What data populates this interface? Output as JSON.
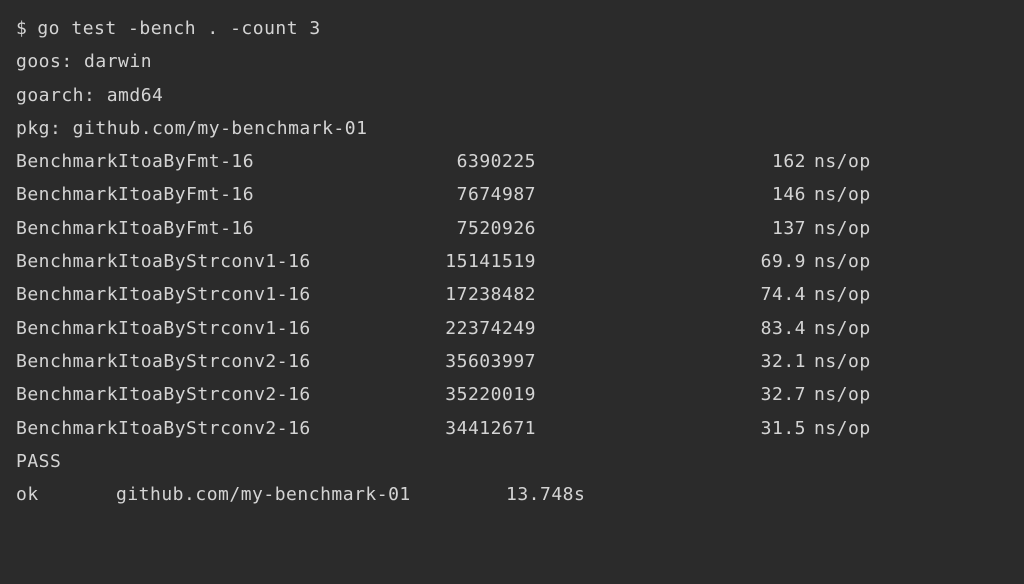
{
  "prompt_symbol": "$",
  "command": "go test -bench . -count 3",
  "header": {
    "goos_line": "goos: darwin",
    "goarch_line": "goarch: amd64",
    "pkg_line": "pkg: github.com/my-benchmark-01"
  },
  "rows": [
    {
      "name": "BenchmarkItoaByFmt-16",
      "iters": "6390225",
      "nsop": "162",
      "unit": "ns/op"
    },
    {
      "name": "BenchmarkItoaByFmt-16",
      "iters": "7674987",
      "nsop": "146",
      "unit": "ns/op"
    },
    {
      "name": "BenchmarkItoaByFmt-16",
      "iters": "7520926",
      "nsop": "137",
      "unit": "ns/op"
    },
    {
      "name": "BenchmarkItoaByStrconv1-16",
      "iters": "15141519",
      "nsop": "69.9",
      "unit": "ns/op"
    },
    {
      "name": "BenchmarkItoaByStrconv1-16",
      "iters": "17238482",
      "nsop": "74.4",
      "unit": "ns/op"
    },
    {
      "name": "BenchmarkItoaByStrconv1-16",
      "iters": "22374249",
      "nsop": "83.4",
      "unit": "ns/op"
    },
    {
      "name": "BenchmarkItoaByStrconv2-16",
      "iters": "35603997",
      "nsop": "32.1",
      "unit": "ns/op"
    },
    {
      "name": "BenchmarkItoaByStrconv2-16",
      "iters": "35220019",
      "nsop": "32.7",
      "unit": "ns/op"
    },
    {
      "name": "BenchmarkItoaByStrconv2-16",
      "iters": "34412671",
      "nsop": "31.5",
      "unit": "ns/op"
    }
  ],
  "pass_line": "PASS",
  "footer": {
    "ok": "ok",
    "pkg": "github.com/my-benchmark-01",
    "elapsed": "13.748s"
  }
}
